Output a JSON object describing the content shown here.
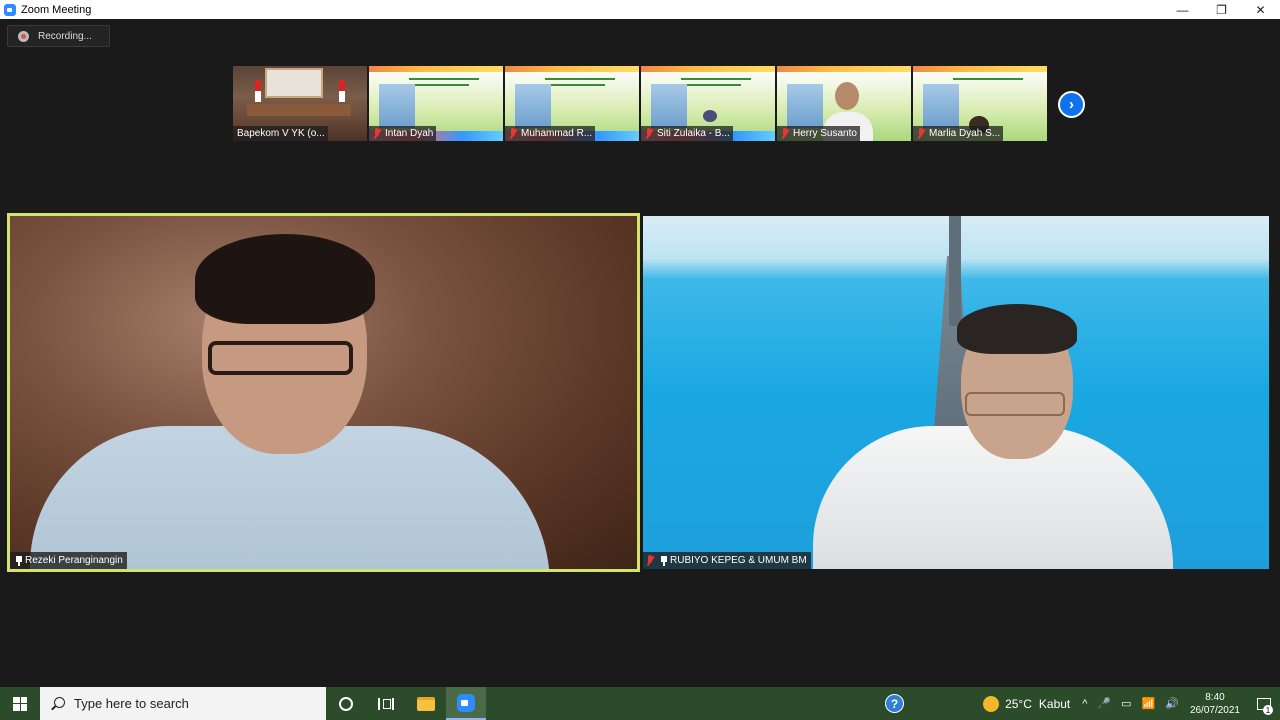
{
  "window": {
    "title": "Zoom Meeting",
    "controls": {
      "minimize": "—",
      "restore": "❐",
      "close": "✕"
    }
  },
  "recording": {
    "label": "Recording..."
  },
  "thumbnails": [
    {
      "name": "Bapekom V YK (o...",
      "muted": false
    },
    {
      "name": "Intan Dyah",
      "muted": true
    },
    {
      "name": "Muhammad R...",
      "muted": true
    },
    {
      "name": "Siti Zulaika - B...",
      "muted": true
    },
    {
      "name": "Herry Susanto",
      "muted": true
    },
    {
      "name": "Marlia Dyah S...",
      "muted": true
    }
  ],
  "next_icon": "›",
  "videos": {
    "left": {
      "name": "Rezeki Peranginangin",
      "pinned": true,
      "active_speaker": true
    },
    "right": {
      "name": "RUBIYO KEPEG & UMUM BM",
      "pinned": true,
      "muted": true
    }
  },
  "taskbar": {
    "search_placeholder": "Type here to search",
    "help_icon": "?",
    "weather": {
      "temp": "25°C",
      "condition": "Kabut"
    },
    "tray_symbols": [
      "^",
      "🎤",
      "▭",
      "📶",
      "🔊"
    ],
    "time": "8:40",
    "date": "26/07/2021",
    "notification_count": "1"
  },
  "colors": {
    "active_speaker_border": "#d3e36b",
    "taskbar_bg": "#2b4b2a",
    "accent": "#0e72ed"
  }
}
